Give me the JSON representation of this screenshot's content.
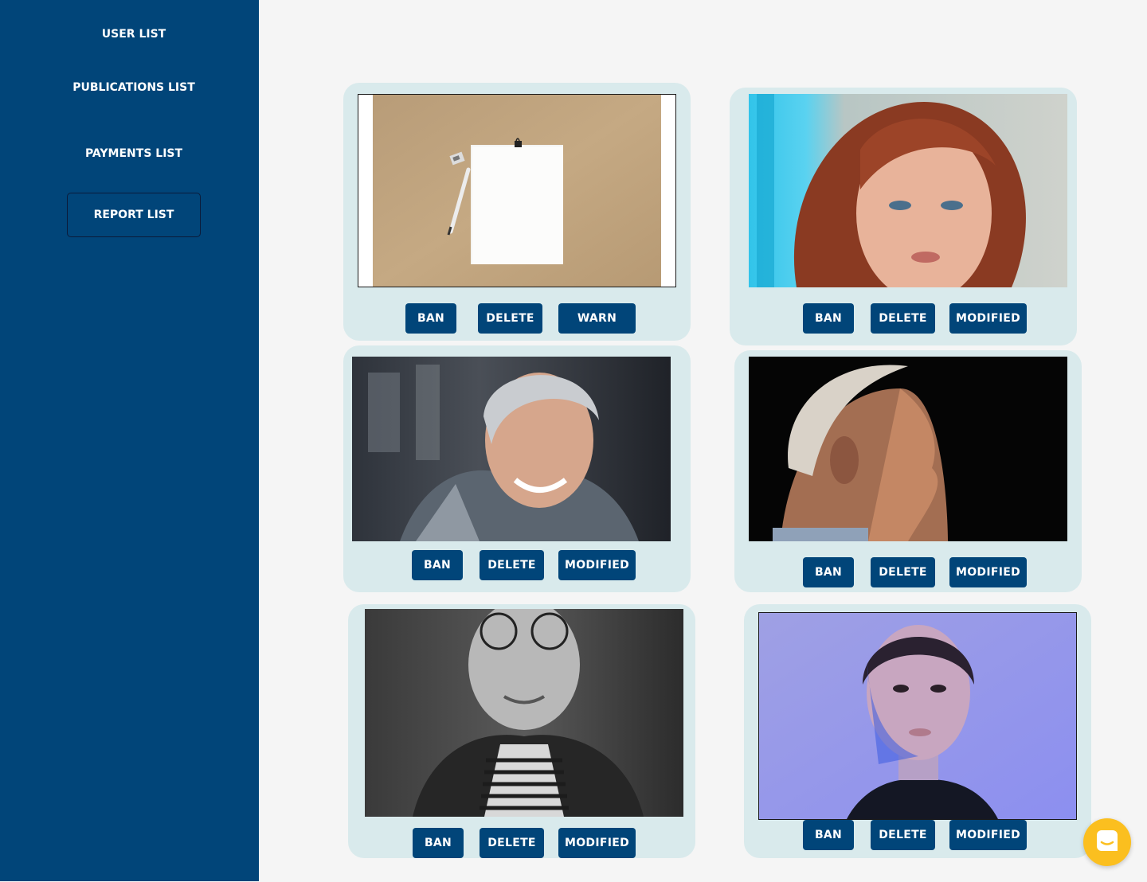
{
  "sidebar": {
    "items": [
      {
        "label": "USER LIST"
      },
      {
        "label": "PUBLICATIONS LIST"
      },
      {
        "label": "PAYMENTS LIST"
      },
      {
        "label": "REPORT LIST",
        "active": true
      }
    ]
  },
  "cards": [
    {
      "photo": "paper-and-pencil-photo",
      "buttons": [
        "BAN",
        "DELETE",
        "WARN"
      ]
    },
    {
      "photo": "red-haired-woman-portrait",
      "buttons": [
        "BAN",
        "DELETE",
        "MODIFIED"
      ]
    },
    {
      "photo": "smiling-elderly-woman-portrait",
      "buttons": [
        "BAN",
        "DELETE",
        "MODIFIED"
      ]
    },
    {
      "photo": "elderly-man-profile-portrait",
      "buttons": [
        "BAN",
        "DELETE",
        "MODIFIED"
      ]
    },
    {
      "photo": "elderly-woman-glasses-bw-portrait",
      "buttons": [
        "BAN",
        "DELETE",
        "MODIFIED"
      ]
    },
    {
      "photo": "woman-purple-light-portrait",
      "buttons": [
        "BAN",
        "DELETE",
        "MODIFIED"
      ]
    }
  ],
  "chat": {
    "icon": "chat-icon"
  },
  "colors": {
    "sidebar": "#014579",
    "button": "#014579",
    "card": "#d9eaec",
    "background": "#f5f5f5",
    "chat_launcher": "#fbbf1f"
  }
}
